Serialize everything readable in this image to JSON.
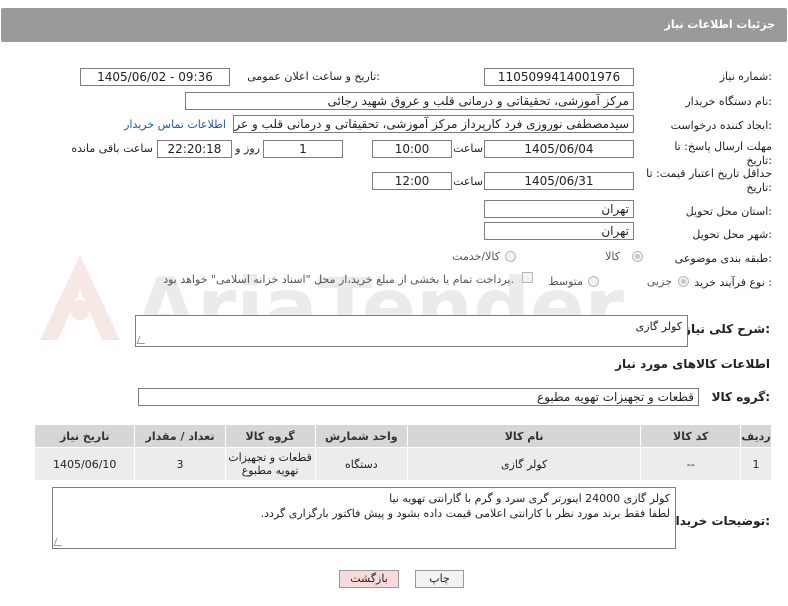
{
  "header": {
    "title": "جزئیات اطلاعات نیاز"
  },
  "fields": {
    "need_number": {
      "label": "شماره نیاز:",
      "value": "1105099414001976"
    },
    "announce_datetime": {
      "label": "تاریخ و ساعت اعلان عمومی:",
      "value": "1405/06/02 - 09:36"
    },
    "buyer_org": {
      "label": "نام دستگاه خریدار:",
      "value": "مرکز آموزشی، تحقیقاتی و درمانی قلب و عروق شهید رجائی"
    },
    "requester": {
      "label": "ایجاد کننده درخواست:",
      "value": "سیدمصطفی نوروزی فرد کارپرداز مرکز آموزشی، تحقیقاتی و درمانی قلب و عروق",
      "contact_link": "اطلاعات تماس خریدار"
    },
    "response_deadline": {
      "label": "مهلت ارسال پاسخ: تا تاریخ:",
      "date": "1405/06/04",
      "time_label": "ساعت",
      "time": "10:00",
      "days": "1",
      "days_label": "روز و",
      "remaining": "22:20:18",
      "remaining_label": "ساعت باقی مانده"
    },
    "price_validity": {
      "label": "حداقل تاریخ اعتبار قیمت: تا تاریخ:",
      "date": "1405/06/31",
      "time_label": "ساعت",
      "time": "12:00"
    },
    "delivery_province": {
      "label": "استان محل تحویل:",
      "value": "تهران"
    },
    "delivery_city": {
      "label": "شهر محل تحویل:",
      "value": "تهران"
    },
    "category": {
      "label": "طبقه بندی موضوعی:",
      "options": [
        "کالا",
        "کالا/خدمت"
      ]
    },
    "process_type": {
      "label": "نوع فرآیند خرید :",
      "options": [
        "جزیی",
        "متوسط"
      ],
      "payment_note": "پرداخت تمام یا بخشی از مبلغ خرید،از محل \"اسناد خزانه اسلامی\" خواهد بود."
    }
  },
  "description": {
    "label": "شرح کلی نیاز:",
    "value": "کولر گازی"
  },
  "goods_info": {
    "title": "اطلاعات کالاهای مورد نیاز"
  },
  "goods_group": {
    "label": "گروه کالا:",
    "value": "قطعات و تجهیزات تهویه مطبوع"
  },
  "table": {
    "headers": [
      "ردیف",
      "کد کالا",
      "نام کالا",
      "واحد شمارش",
      "گروه کالا",
      "تعداد / مقدار",
      "تاریخ نیاز"
    ],
    "rows": [
      [
        "1",
        "--",
        "کولر گازی",
        "دستگاه",
        "قطعات و تجهیزات تهویه مطبوع",
        "3",
        "1405/06/10"
      ]
    ]
  },
  "buyer_notes": {
    "label": "توضیحات خریدار:",
    "line1": "کولر گازی 24000 اینورتر گری سرد و گرم با گارانتی تهویه نیا",
    "line2": "لطفا فقط برند مورد نظر با کارانتی اعلامی قیمت داده بشود و پیش فاکتور بارگزاری گردد."
  },
  "buttons": {
    "print": "چاپ",
    "back": "بازگشت"
  },
  "watermark": {
    "text": "AriaTender.neT"
  },
  "colors": {
    "header_bg": "#9a9a9a",
    "link": "#1a5aa6",
    "back_button_bg": "#f9dada",
    "table_header": "#d6d6d6"
  }
}
